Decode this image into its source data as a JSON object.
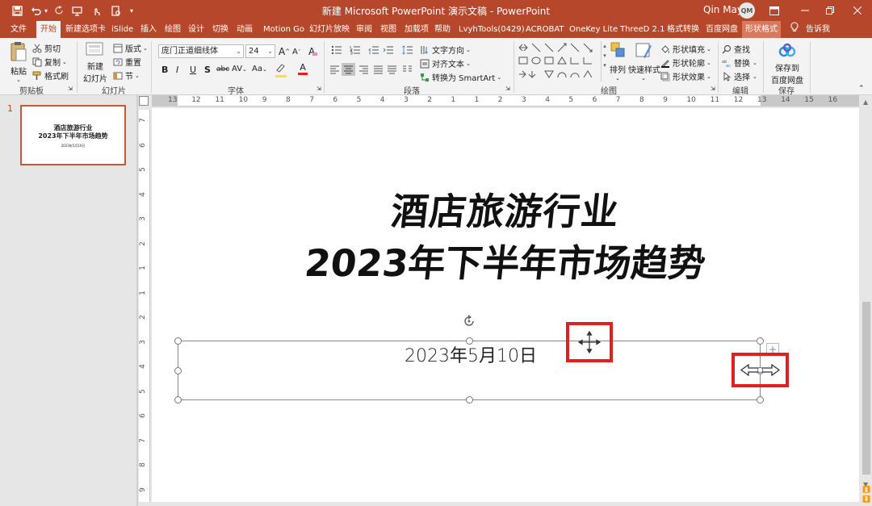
{
  "titlebar": {
    "title": "新建 Microsoft PowerPoint 演示文稿 - PowerPoint",
    "user_name": "Qin May",
    "user_initials": "QM",
    "save_icon": "save-icon",
    "undo_icon": "undo-icon",
    "redo_icon": "redo-icon",
    "customize_icon": "chevron-down-icon"
  },
  "colors": {
    "accent": "#b7472a",
    "selection_red": "#e02020",
    "ribbon_bg": "#f3f3f3"
  },
  "menubar": {
    "tabs": [
      "文件",
      "开始",
      "新建选项卡",
      "iSlide",
      "插入",
      "绘图",
      "设计",
      "切换",
      "动画",
      "Motion Go",
      "幻灯片放映",
      "审阅",
      "视图",
      "加载项",
      "帮助",
      "LvyhTools(0429)",
      "ACROBAT",
      "OneKey Lite",
      "ThreeD 2.1",
      "格式转换",
      "百度网盘",
      "形状格式"
    ],
    "tell_me": "告诉我"
  },
  "ribbon": {
    "clipboard": {
      "paste": "粘贴",
      "cut": "剪切",
      "copy": "复制",
      "format_painter": "格式刷",
      "label": "剪贴板"
    },
    "slides": {
      "new_slide_line1": "新建",
      "new_slide_line2": "幻灯片",
      "layout": "版式",
      "reset": "重置",
      "section": "节",
      "label": "幻灯片"
    },
    "font": {
      "font_name": "庞门正道细线体",
      "font_size": "24",
      "bold": "B",
      "italic": "I",
      "underline": "U",
      "shadow": "S",
      "strike": "abc",
      "spacing": "AV",
      "case": "Aa",
      "grow": "A",
      "shrink": "A",
      "clear": "A",
      "label": "字体"
    },
    "paragraph": {
      "text_direction": "文字方向",
      "align_text": "对齐文本",
      "smartart": "转换为 SmartArt",
      "label": "段落"
    },
    "drawing": {
      "arrange": "排列",
      "quick_styles": "快速样式",
      "shape_fill": "形状填充",
      "shape_outline": "形状轮廓",
      "shape_effects": "形状效果",
      "label": "绘图"
    },
    "editing": {
      "find": "查找",
      "replace": "替换",
      "select": "选择",
      "label": "编辑"
    },
    "save": {
      "line1": "保存到",
      "line2": "百度网盘",
      "label": "保存"
    }
  },
  "hruler": {
    "labels": [
      "13",
      "12",
      "11",
      "10",
      "9",
      "8",
      "7",
      "6",
      "5",
      "4",
      "3",
      "2",
      "1",
      "1",
      "2",
      "3",
      "4",
      "5",
      "6",
      "7",
      "8",
      "9",
      "10",
      "11",
      "12",
      "13",
      "14",
      "15",
      "16"
    ]
  },
  "vruler": {
    "labels": [
      "7",
      "6",
      "5",
      "4",
      "3",
      "2",
      "1",
      "1",
      "2",
      "3",
      "4",
      "5",
      "6",
      "7",
      "8",
      "9"
    ]
  },
  "thumbnail": {
    "number": "1",
    "title_line1": "酒店旅游行业",
    "title_line2": "2023年下半年市场趋势",
    "date": "2023年5月10日"
  },
  "slide": {
    "title_line1": "酒店旅游行业",
    "title_line2": "2023年下半年市场趋势",
    "date_text": "2023年5月10日"
  },
  "cursors": {
    "move": "move-cursor-icon",
    "resize": "resize-horizontal-cursor-icon",
    "rotate": "rotate-handle-icon"
  }
}
